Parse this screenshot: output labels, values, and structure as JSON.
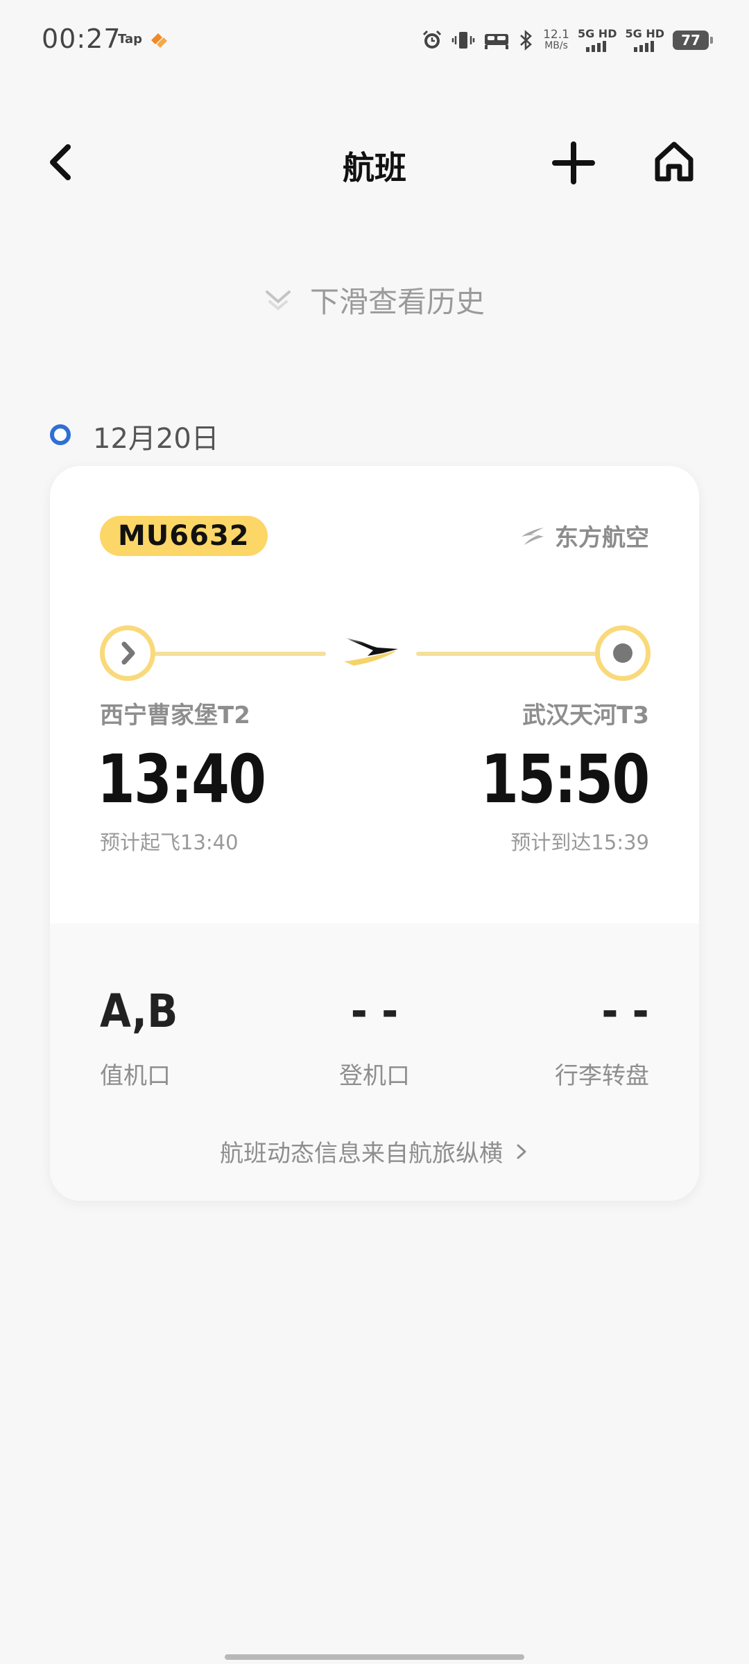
{
  "status_bar": {
    "time": "00:27",
    "tap_label": "Tap",
    "net_speed_value": "12.1",
    "net_speed_unit": "MB/s",
    "sim1_label": "5G HD",
    "sim2_label": "5G HD",
    "battery": "77"
  },
  "nav": {
    "title": "航班"
  },
  "pull_hint": "下滑查看历史",
  "date": "12月20日",
  "flight": {
    "number": "MU6632",
    "airline": "东方航空",
    "departure": {
      "airport": "西宁曹家堡T2",
      "time": "13:40",
      "estimate": "预计起飞13:40"
    },
    "arrival": {
      "airport": "武汉天河T3",
      "time": "15:50",
      "estimate": "预计到达15:39"
    },
    "checkin": {
      "value": "A,B",
      "label": "值机口"
    },
    "gate": {
      "value": "- -",
      "label": "登机口"
    },
    "baggage": {
      "value": "- -",
      "label": "行李转盘"
    },
    "source": "航班动态信息来自航旅纵横"
  },
  "colors": {
    "accent_yellow": "#fcd667",
    "date_dot_blue": "#2f6fd6"
  }
}
